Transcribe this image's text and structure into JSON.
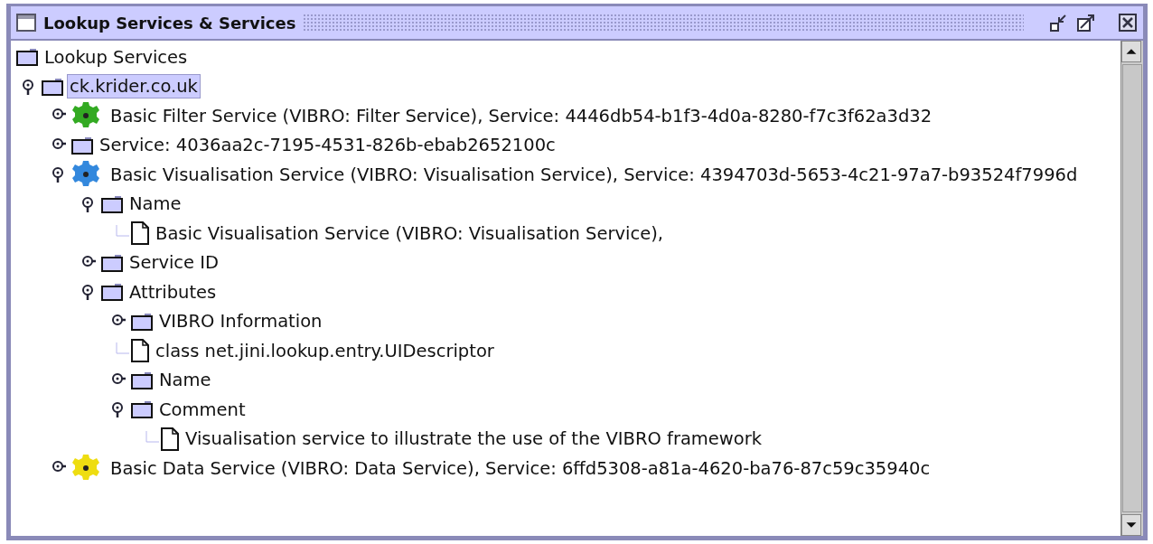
{
  "window": {
    "title": "Lookup Services & Services"
  },
  "tree": {
    "label": "Lookup Services",
    "kind": "folder",
    "selected": false,
    "children": [
      {
        "label": "ck.krider.co.uk",
        "kind": "folder",
        "expanded": true,
        "selected": true,
        "children": [
          {
            "label": "Basic Filter Service (VIBRO: Filter Service), Service: 4446db54-b1f3-4d0a-8280-f7c3f62a3d32",
            "kind": "gear",
            "color": "#33aa22",
            "expanded": false,
            "selected": false
          },
          {
            "label": "Service: 4036aa2c-7195-4531-826b-ebab2652100c",
            "kind": "folder",
            "expanded": false,
            "selected": false
          },
          {
            "label": "Basic Visualisation Service (VIBRO: Visualisation Service), Service: 4394703d-5653-4c21-97a7-b93524f7996d",
            "kind": "gear",
            "color": "#3388dd",
            "expanded": true,
            "selected": false,
            "children": [
              {
                "label": "Name",
                "kind": "folder",
                "expanded": true,
                "selected": false,
                "children": [
                  {
                    "label": "Basic Visualisation Service (VIBRO: Visualisation Service),",
                    "kind": "document",
                    "selected": false
                  }
                ]
              },
              {
                "label": "Service ID",
                "kind": "folder",
                "expanded": false,
                "selected": false
              },
              {
                "label": "Attributes",
                "kind": "folder",
                "expanded": true,
                "selected": false,
                "children": [
                  {
                    "label": "VIBRO Information",
                    "kind": "folder",
                    "expanded": false,
                    "selected": false
                  },
                  {
                    "label": "class net.jini.lookup.entry.UIDescriptor",
                    "kind": "document",
                    "selected": false
                  },
                  {
                    "label": "Name",
                    "kind": "folder",
                    "expanded": false,
                    "selected": false
                  },
                  {
                    "label": "Comment",
                    "kind": "folder",
                    "expanded": true,
                    "selected": false,
                    "children": [
                      {
                        "label": "Visualisation service to illustrate the use of the VIBRO framework",
                        "kind": "document",
                        "selected": false
                      }
                    ]
                  }
                ]
              }
            ]
          },
          {
            "label": "Basic Data Service (VIBRO: Data Service), Service: 6ffd5308-a81a-4620-ba76-87c59c35940c",
            "kind": "gear",
            "color": "#eedd11",
            "expanded": false,
            "selected": false
          }
        ]
      }
    ]
  }
}
